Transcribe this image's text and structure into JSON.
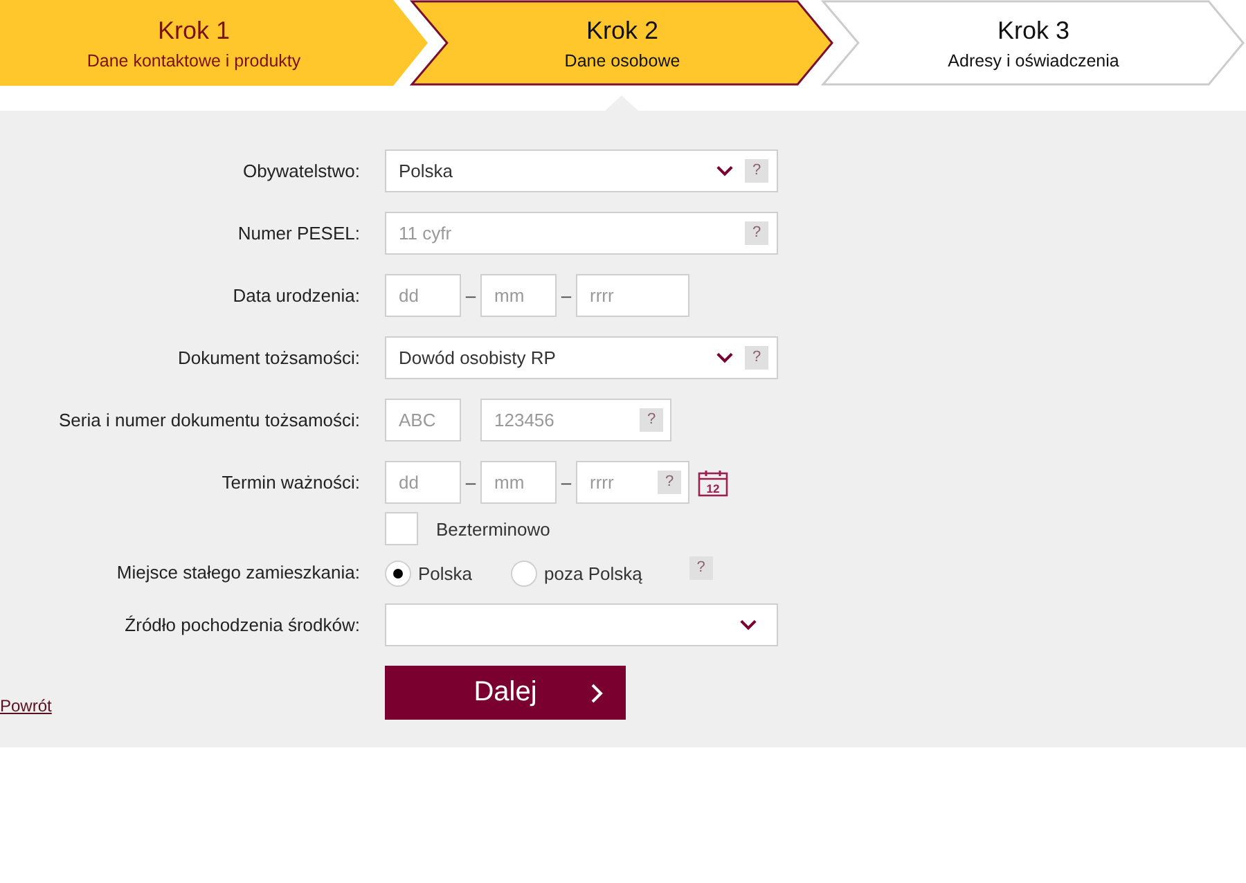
{
  "steps": [
    {
      "title": "Krok 1",
      "subtitle": "Dane kontaktowe i produkty",
      "kind": "done"
    },
    {
      "title": "Krok 2",
      "subtitle": "Dane osobowe",
      "kind": "current"
    },
    {
      "title": "Krok 3",
      "subtitle": "Adresy i oświadczenia",
      "kind": "todo"
    }
  ],
  "form": [
    {
      "kind": "select",
      "label": "Obywatelstwo:",
      "value": "Polska",
      "help": "?"
    },
    {
      "kind": "input",
      "label": "Numer PESEL:",
      "placeholder": "11 cyfr",
      "help": "?"
    },
    {
      "kind": "date",
      "label": "Data urodzenia:",
      "parts": [
        {
          "placeholder": "dd"
        },
        {
          "separator": "–",
          "placeholder": "mm"
        },
        {
          "separator": "–",
          "placeholder": "rrrr"
        }
      ]
    },
    {
      "kind": "select",
      "label": "Dokument tożsamości:",
      "value": "Dowód osobisty RP",
      "help": "?"
    },
    {
      "kind": "pair",
      "label": "Seria i numer dokumentu tożsamości:",
      "parts": [
        {
          "placeholder": "ABC"
        },
        {
          "placeholder": "123456",
          "help": "?"
        }
      ]
    },
    {
      "kind": "date",
      "label": "Termin ważności:",
      "parts": [
        {
          "placeholder": "dd"
        },
        {
          "separator": "–",
          "placeholder": "mm"
        },
        {
          "separator": "–",
          "placeholder": "rrrr",
          "help": "?"
        }
      ],
      "calendar": "12"
    },
    {
      "kind": "checkbox",
      "label": "Bezterminowo",
      "checked": false
    },
    {
      "kind": "radio",
      "label": "Miejsce stałego zamieszkania:",
      "options": [
        {
          "label": "Polska",
          "selected": true
        },
        {
          "label": "poza Polską",
          "selected": false
        }
      ],
      "help": "?"
    },
    {
      "kind": "select",
      "label": "Źródło pochodzenia środków:"
    }
  ],
  "back_link": "Powrót",
  "next_button": "Dalej"
}
